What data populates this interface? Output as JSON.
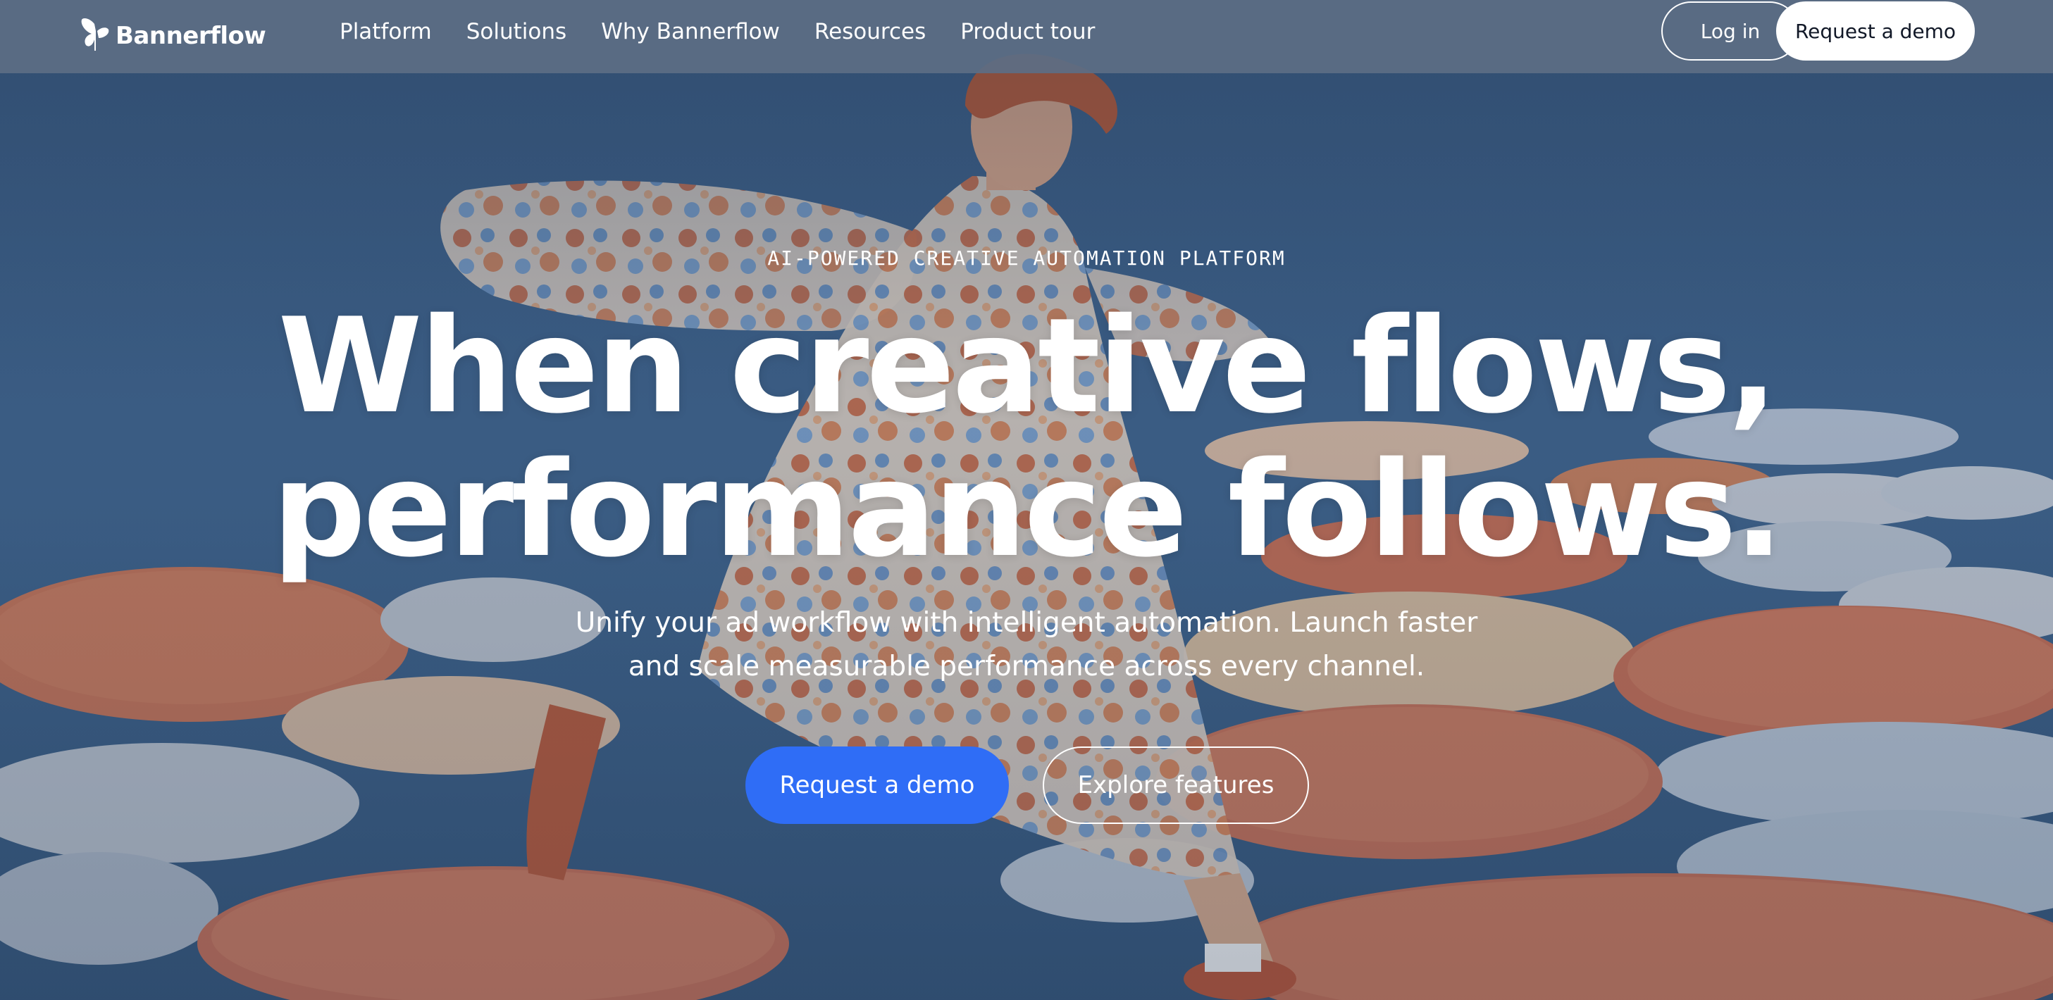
{
  "brand": {
    "name": "Bannerflow",
    "logo_icon": "butterfly-icon"
  },
  "nav": {
    "items": [
      {
        "label": "Platform"
      },
      {
        "label": "Solutions"
      },
      {
        "label": "Why Bannerflow"
      },
      {
        "label": "Resources"
      },
      {
        "label": "Product tour"
      }
    ],
    "login_label": "Log in",
    "demo_label": "Request a demo"
  },
  "hero": {
    "eyebrow": "AI-POWERED CREATIVE AUTOMATION PLATFORM",
    "headline_line1": "When creative flows,",
    "headline_line2": "performance follows.",
    "subtitle_line1": "Unify your ad workflow with intelligent automation. Launch faster",
    "subtitle_line2": "and scale measurable performance across every channel.",
    "primary_cta": "Request a demo",
    "secondary_cta": "Explore features"
  },
  "colors": {
    "accent": "#2f6df6",
    "nav_background": "#5c6e84",
    "water": "#3d5f86",
    "lily_pad_orange": "#c77558",
    "lily_pad_pale": "#c9ccd3"
  }
}
